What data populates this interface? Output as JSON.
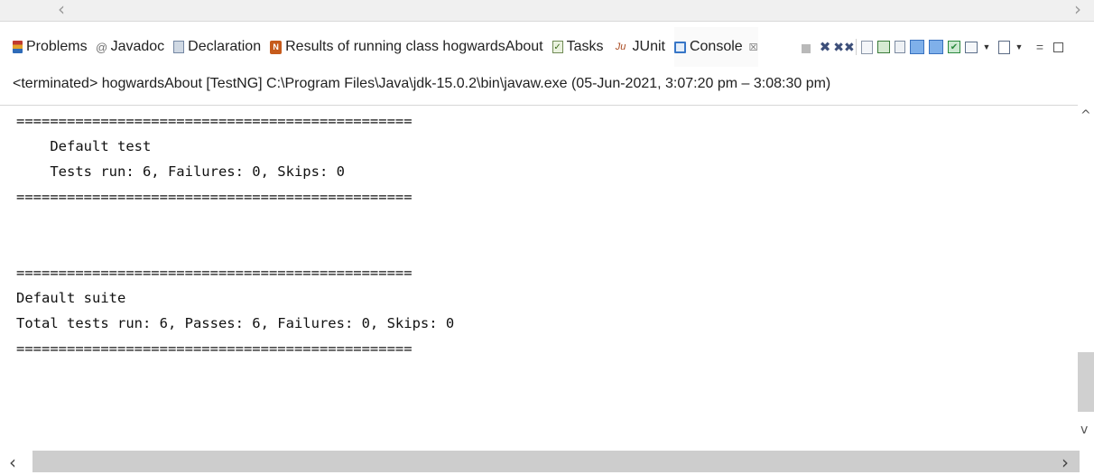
{
  "tabs": [
    {
      "label": "Problems",
      "icon": "problems-icon"
    },
    {
      "label": "Javadoc",
      "icon": "javadoc-icon",
      "glyph": "@"
    },
    {
      "label": "Declaration",
      "icon": "declaration-icon"
    },
    {
      "label": "Results of running class hogwardsAbout",
      "icon": "testng-results-icon",
      "glyph": "N"
    },
    {
      "label": "Tasks",
      "icon": "tasks-icon",
      "glyph": "✓"
    },
    {
      "label": "JUnit",
      "icon": "junit-icon",
      "glyph": "Ju"
    },
    {
      "label": "Console",
      "icon": "console-icon",
      "active": true,
      "close_glyph": "☒"
    }
  ],
  "toolbar": {
    "glyphs": {
      "x": "✖",
      "xx": "✖✖",
      "caret": "▼",
      "min": "=",
      "check": "✔"
    }
  },
  "status_line": "<terminated> hogwardsAbout [TestNG] C:\\Program Files\\Java\\jdk-15.0.2\\bin\\javaw.exe  (05-Jun-2021, 3:07:20 pm – 3:08:30 pm)",
  "console": {
    "lines": [
      "===============================================",
      "    Default test",
      "    Tests run: 6, Failures: 0, Skips: 0",
      "===============================================",
      "",
      "",
      "===============================================",
      "Default suite",
      "Total tests run: 6, Passes: 6, Failures: 0, Skips: 0",
      "==============================================="
    ]
  },
  "scroll": {
    "left_arrow": "‹",
    "right_arrow": "›",
    "up_arrow": "^",
    "down_arrow": "v",
    "top_left_arrow": "‹",
    "top_right_arrow": "›"
  }
}
